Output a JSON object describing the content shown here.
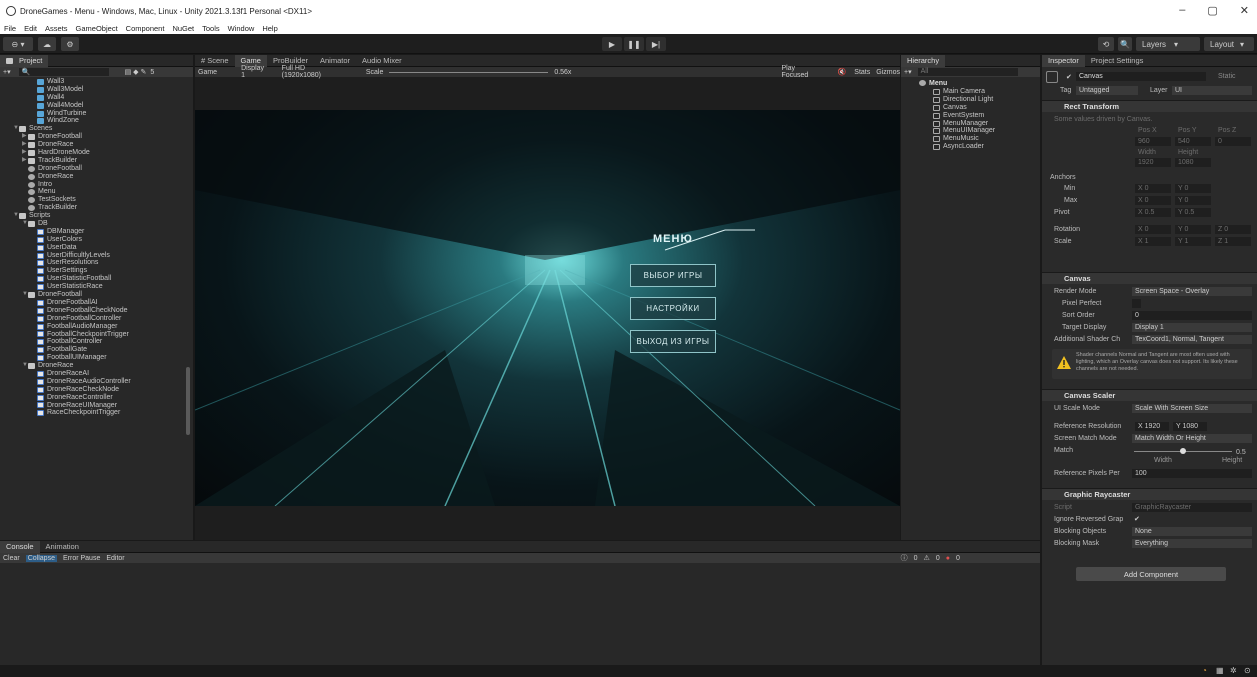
{
  "window": {
    "title": "DroneGames - Menu - Windows, Mac, Linux - Unity 2021.3.13f1 Personal <DX11>",
    "minimize": "–",
    "maximize": "▢",
    "close": "✕"
  },
  "menubar": [
    "File",
    "Edit",
    "Assets",
    "GameObject",
    "Component",
    "NuGet",
    "Tools",
    "Window",
    "Help"
  ],
  "toolbar": {
    "account_label": "⊖ ▾",
    "cloud_label": "☁",
    "settings_label": "⚙",
    "play_label": "▶",
    "pause_label": "❚❚",
    "step_label": "▶|",
    "history_label": "⟲",
    "search_label": "🔍",
    "layers_label": "Layers",
    "layout_label": "Layout"
  },
  "project": {
    "tab_label": "Project",
    "search_placeholder": "🔍",
    "count_label": "5",
    "rows": [
      {
        "indent": 3,
        "icon": "prefab",
        "label": "Wall3"
      },
      {
        "indent": 3,
        "icon": "prefab",
        "label": "Wall3Model"
      },
      {
        "indent": 3,
        "icon": "prefab",
        "label": "Wall4"
      },
      {
        "indent": 3,
        "icon": "prefab",
        "label": "Wall4Model"
      },
      {
        "indent": 3,
        "icon": "prefab",
        "label": "WindTurbine"
      },
      {
        "indent": 3,
        "icon": "prefab",
        "label": "WindZone"
      },
      {
        "indent": 1,
        "icon": "folder",
        "label": "Scenes",
        "arrow": "▼"
      },
      {
        "indent": 2,
        "icon": "folder",
        "label": "DroneFootball",
        "arrow": "▶"
      },
      {
        "indent": 2,
        "icon": "folder",
        "label": "DroneRace",
        "arrow": "▶"
      },
      {
        "indent": 2,
        "icon": "folder",
        "label": "HardDroneMode",
        "arrow": "▶"
      },
      {
        "indent": 2,
        "icon": "folder",
        "label": "TrackBuilder",
        "arrow": "▶"
      },
      {
        "indent": 2,
        "icon": "scene",
        "label": "DroneFootball"
      },
      {
        "indent": 2,
        "icon": "scene",
        "label": "DroneRace"
      },
      {
        "indent": 2,
        "icon": "scene",
        "label": "Intro"
      },
      {
        "indent": 2,
        "icon": "scene",
        "label": "Menu"
      },
      {
        "indent": 2,
        "icon": "scene",
        "label": "TestSockets"
      },
      {
        "indent": 2,
        "icon": "scene",
        "label": "TrackBuilder"
      },
      {
        "indent": 1,
        "icon": "folder",
        "label": "Scripts",
        "arrow": "▼"
      },
      {
        "indent": 2,
        "icon": "folder",
        "label": "DB",
        "arrow": "▼"
      },
      {
        "indent": 3,
        "icon": "script",
        "label": "DBManager"
      },
      {
        "indent": 3,
        "icon": "script",
        "label": "UserColors"
      },
      {
        "indent": 3,
        "icon": "script",
        "label": "UserData"
      },
      {
        "indent": 3,
        "icon": "script",
        "label": "UserDifficultlyLevels"
      },
      {
        "indent": 3,
        "icon": "script",
        "label": "UserResolutions"
      },
      {
        "indent": 3,
        "icon": "script",
        "label": "UserSettings"
      },
      {
        "indent": 3,
        "icon": "script",
        "label": "UserStatisticFootball"
      },
      {
        "indent": 3,
        "icon": "script",
        "label": "UserStatisticRace"
      },
      {
        "indent": 2,
        "icon": "folder",
        "label": "DroneFootball",
        "arrow": "▼"
      },
      {
        "indent": 3,
        "icon": "script",
        "label": "DroneFootballAI"
      },
      {
        "indent": 3,
        "icon": "script",
        "label": "DroneFootballCheckNode"
      },
      {
        "indent": 3,
        "icon": "script",
        "label": "DroneFootballController"
      },
      {
        "indent": 3,
        "icon": "script",
        "label": "FootballAudioManager"
      },
      {
        "indent": 3,
        "icon": "script",
        "label": "FootballCheckpointTrigger"
      },
      {
        "indent": 3,
        "icon": "script",
        "label": "FootballController"
      },
      {
        "indent": 3,
        "icon": "script",
        "label": "FootballGate"
      },
      {
        "indent": 3,
        "icon": "script",
        "label": "FootballUIManager"
      },
      {
        "indent": 2,
        "icon": "folder",
        "label": "DroneRace",
        "arrow": "▼"
      },
      {
        "indent": 3,
        "icon": "script",
        "label": "DroneRaceAI"
      },
      {
        "indent": 3,
        "icon": "script",
        "label": "DroneRaceAudioController"
      },
      {
        "indent": 3,
        "icon": "script",
        "label": "DroneRaceCheckNode"
      },
      {
        "indent": 3,
        "icon": "script",
        "label": "DroneRaceController"
      },
      {
        "indent": 3,
        "icon": "script",
        "label": "DroneRaceUIManager"
      },
      {
        "indent": 3,
        "icon": "script",
        "label": "RaceCheckpointTrigger"
      }
    ]
  },
  "scene_tabs": {
    "tabs": [
      "# Scene",
      "Game",
      "ProBuilder",
      "Animator",
      "Audio Mixer"
    ],
    "game_label": "Game",
    "display": "Display 1",
    "resolution": "Full HD (1920x1080)",
    "scale_label": "Scale",
    "scale_value": "0.56x",
    "play_focused": "Play Focused",
    "stats": "Stats",
    "gizmos": "Gizmos"
  },
  "game_menu": {
    "title": "МЕНЮ",
    "buttons": [
      "ВЫБОР ИГРЫ",
      "НАСТРОЙКИ",
      "ВЫХОД ИЗ ИГРЫ"
    ]
  },
  "hierarchy": {
    "tab_label": "Hierarchy",
    "search_placeholder": "All",
    "scene": "Menu",
    "items": [
      "Main Camera",
      "Directional Light",
      "Canvas",
      "EventSystem",
      "MenuManager",
      "MenuUIManager",
      "MenuMusic",
      "AsyncLoader"
    ]
  },
  "inspector": {
    "tab_label": "Inspector",
    "settings_tab": "Project Settings",
    "object_name": "Canvas",
    "static_label": "Static",
    "tag_label": "Tag",
    "tag_value": "Untagged",
    "layer_label": "Layer",
    "layer_value": "UI",
    "rect_transform": {
      "title": "Rect Transform",
      "note": "Some values driven by Canvas.",
      "pos_x_label": "Pos X",
      "pos_y_label": "Pos Y",
      "pos_z_label": "Pos Z",
      "pos_x": "960",
      "pos_y": "540",
      "pos_z": "0",
      "width_label": "Width",
      "height_label": "Height",
      "width": "1920",
      "height": "1080",
      "anchors": "Anchors",
      "min_label": "Min",
      "max_label": "Max",
      "pivot_label": "Pivot",
      "min_x": "X 0",
      "min_y": "Y 0",
      "max_x": "X 0",
      "max_y": "Y 0",
      "pivot_x": "X 0.5",
      "pivot_y": "Y 0.5",
      "rotation_label": "Rotation",
      "scale_label": "Scale",
      "rot_x": "X 0",
      "rot_y": "Y 0",
      "rot_z": "Z 0",
      "scale_x": "X 1",
      "scale_y": "Y 1",
      "scale_z": "Z 1"
    },
    "canvas": {
      "title": "Canvas",
      "render_mode_label": "Render Mode",
      "render_mode": "Screen Space - Overlay",
      "pixel_perfect_label": "Pixel Perfect",
      "sort_order_label": "Sort Order",
      "sort_order": "0",
      "target_display_label": "Target Display",
      "target_display": "Display 1",
      "shader_ch_label": "Additional Shader Ch",
      "shader_ch": "TexCoord1, Normal, Tangent",
      "warning": "Shader channels Normal and Tangent are most often used with lighting, which an Overlay canvas does not support. Its likely these channels are not needed."
    },
    "scaler": {
      "title": "Canvas Scaler",
      "ui_scale_label": "UI Scale Mode",
      "ui_scale": "Scale With Screen Size",
      "ref_res_label": "Reference Resolution",
      "ref_x": "X  1920",
      "ref_y": "Y  1080",
      "match_mode_label": "Screen Match Mode",
      "match_mode": "Match Width Or Height",
      "match_label": "Match",
      "match_value": "0.5",
      "match_fraction": 0.5,
      "width_label": "Width",
      "height_label": "Height",
      "ppu_label": "Reference Pixels Per",
      "ppu": "100"
    },
    "raycaster": {
      "title": "Graphic Raycaster",
      "script_label": "Script",
      "script": "GraphicRaycaster",
      "ignore_label": "Ignore Reversed Grap",
      "blocking_objects_label": "Blocking Objects",
      "blocking_objects": "None",
      "blocking_mask_label": "Blocking Mask",
      "blocking_mask": "Everything"
    },
    "add_component": "Add Component"
  },
  "console": {
    "tabs": [
      "Console",
      "Animation"
    ],
    "clear": "Clear",
    "collapse": "Collapse",
    "error_pause": "Error Pause",
    "editor": "Editor",
    "errors": "0",
    "warnings": "0",
    "logs": "0"
  },
  "colors": {
    "accent": "#2d5d87",
    "game_teal": "#4fb8c0"
  }
}
